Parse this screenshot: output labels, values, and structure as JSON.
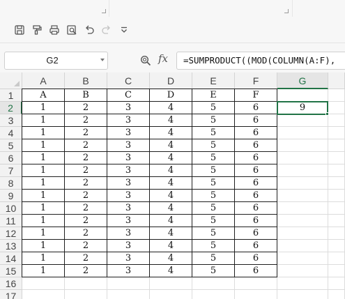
{
  "toolbar": {
    "icons": [
      "save-icon",
      "format-painter-icon",
      "print-icon",
      "print-preview-icon",
      "undo-icon",
      "redo-icon",
      "customize-icon"
    ]
  },
  "formula_bar": {
    "cell_reference": "G2",
    "fx_label": "fx",
    "formula": "=SUMPRODUCT((MOD(COLUMN(A:F),"
  },
  "sheet": {
    "columns": [
      "A",
      "B",
      "C",
      "D",
      "E",
      "F",
      "G"
    ],
    "rows": [
      "1",
      "2",
      "3",
      "4",
      "5",
      "6",
      "7",
      "8",
      "9",
      "10",
      "11",
      "12",
      "13",
      "14",
      "15",
      "16",
      "17"
    ],
    "active_cell": {
      "column": "G",
      "row": "2",
      "value": "9"
    },
    "cells": [
      [
        "A",
        "B",
        "C",
        "D",
        "E",
        "F"
      ],
      [
        "1",
        "2",
        "3",
        "4",
        "5",
        "6"
      ],
      [
        "1",
        "2",
        "3",
        "4",
        "5",
        "6"
      ],
      [
        "1",
        "2",
        "3",
        "4",
        "5",
        "6"
      ],
      [
        "1",
        "2",
        "3",
        "4",
        "5",
        "6"
      ],
      [
        "1",
        "2",
        "3",
        "4",
        "5",
        "6"
      ],
      [
        "1",
        "2",
        "3",
        "4",
        "5",
        "6"
      ],
      [
        "1",
        "2",
        "3",
        "4",
        "5",
        "6"
      ],
      [
        "1",
        "2",
        "3",
        "4",
        "5",
        "6"
      ],
      [
        "1",
        "2",
        "3",
        "4",
        "5",
        "6"
      ],
      [
        "1",
        "2",
        "3",
        "4",
        "5",
        "6"
      ],
      [
        "1",
        "2",
        "3",
        "4",
        "5",
        "6"
      ],
      [
        "1",
        "2",
        "3",
        "4",
        "5",
        "6"
      ],
      [
        "1",
        "2",
        "3",
        "4",
        "5",
        "6"
      ],
      [
        "1",
        "2",
        "3",
        "4",
        "5",
        "6"
      ]
    ]
  },
  "colors": {
    "accent": "#217346",
    "header_bg": "#f2f2f2",
    "gridline": "#dcdcdc",
    "border": "#1e1e1e"
  }
}
